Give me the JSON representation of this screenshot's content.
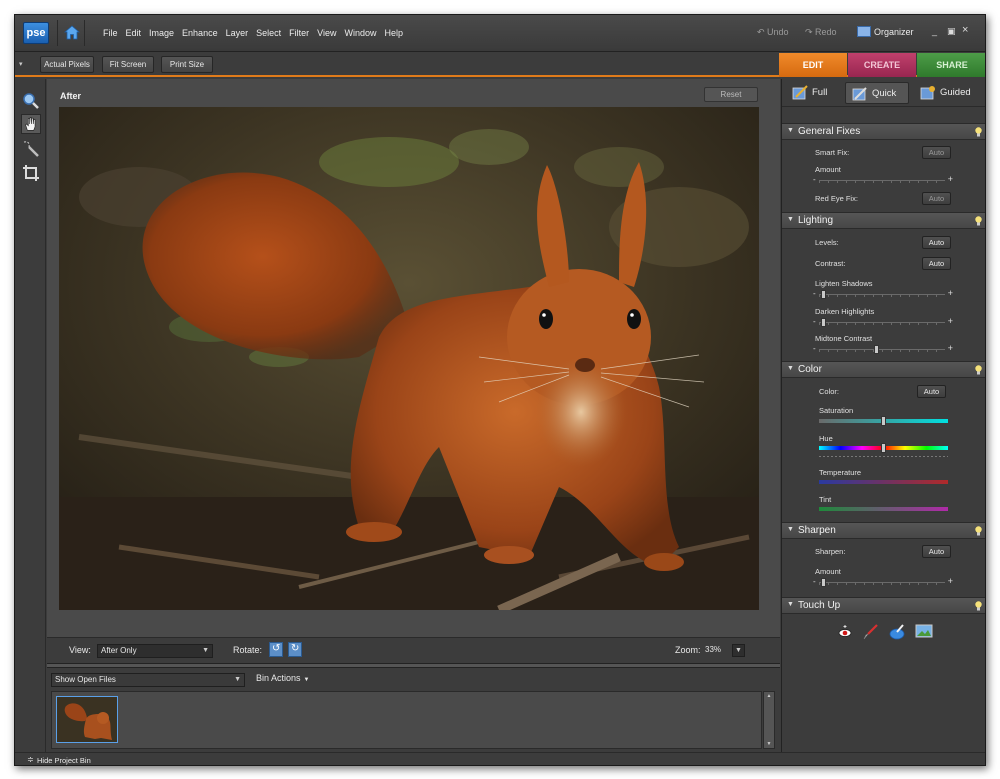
{
  "app": {
    "logo": "pse"
  },
  "menu": [
    "File",
    "Edit",
    "Image",
    "Enhance",
    "Layer",
    "Select",
    "Filter",
    "View",
    "Window",
    "Help"
  ],
  "topright": {
    "undo": "Undo",
    "redo": "Redo",
    "organizer": "Organizer",
    "minimize": "_",
    "restore": "▣",
    "close": "×"
  },
  "optbar": {
    "actual_pixels": "Actual Pixels",
    "fit_screen": "Fit Screen",
    "print_size": "Print Size"
  },
  "main_tabs": [
    {
      "label": "EDIT",
      "color": "#e8781c"
    },
    {
      "label": "CREATE",
      "color": "#b0305c"
    },
    {
      "label": "SHARE",
      "color": "#3d8a3a"
    }
  ],
  "canvas": {
    "label": "After",
    "reset": "Reset"
  },
  "viewbar": {
    "view_label": "View:",
    "view_value": "After Only",
    "rotate_label": "Rotate:",
    "zoom_label": "Zoom:",
    "zoom_value": "33%"
  },
  "bin": {
    "dropdown": "Show Open Files",
    "actions": "Bin Actions"
  },
  "footer": {
    "hide_bin": "Hide Project Bin"
  },
  "modes": [
    {
      "label": "Full",
      "active": false
    },
    {
      "label": "Quick",
      "active": true
    },
    {
      "label": "Guided",
      "active": false
    }
  ],
  "sections": {
    "general": {
      "title": "General Fixes",
      "smart_fix": "Smart Fix:",
      "amount": "Amount",
      "red_eye": "Red Eye Fix:",
      "auto": "Auto"
    },
    "lighting": {
      "title": "Lighting",
      "levels": "Levels:",
      "contrast": "Contrast:",
      "lighten": "Lighten Shadows",
      "darken": "Darken Highlights",
      "midtone": "Midtone Contrast",
      "auto": "Auto"
    },
    "color": {
      "title": "Color",
      "color": "Color:",
      "saturation": "Saturation",
      "hue": "Hue",
      "temperature": "Temperature",
      "tint": "Tint",
      "auto": "Auto"
    },
    "sharpen": {
      "title": "Sharpen",
      "sharpen": "Sharpen:",
      "amount": "Amount",
      "auto": "Auto"
    },
    "touchup": {
      "title": "Touch Up"
    }
  },
  "slider_marks": {
    "minus": "-",
    "plus": "+"
  },
  "slider_levels": {
    "amount": 0.0,
    "lighten": 0.0,
    "darken": 0.0,
    "midtone": 0.45,
    "saturation": 0.5,
    "hue": 0.5,
    "sharpen_amount": 0.0
  }
}
